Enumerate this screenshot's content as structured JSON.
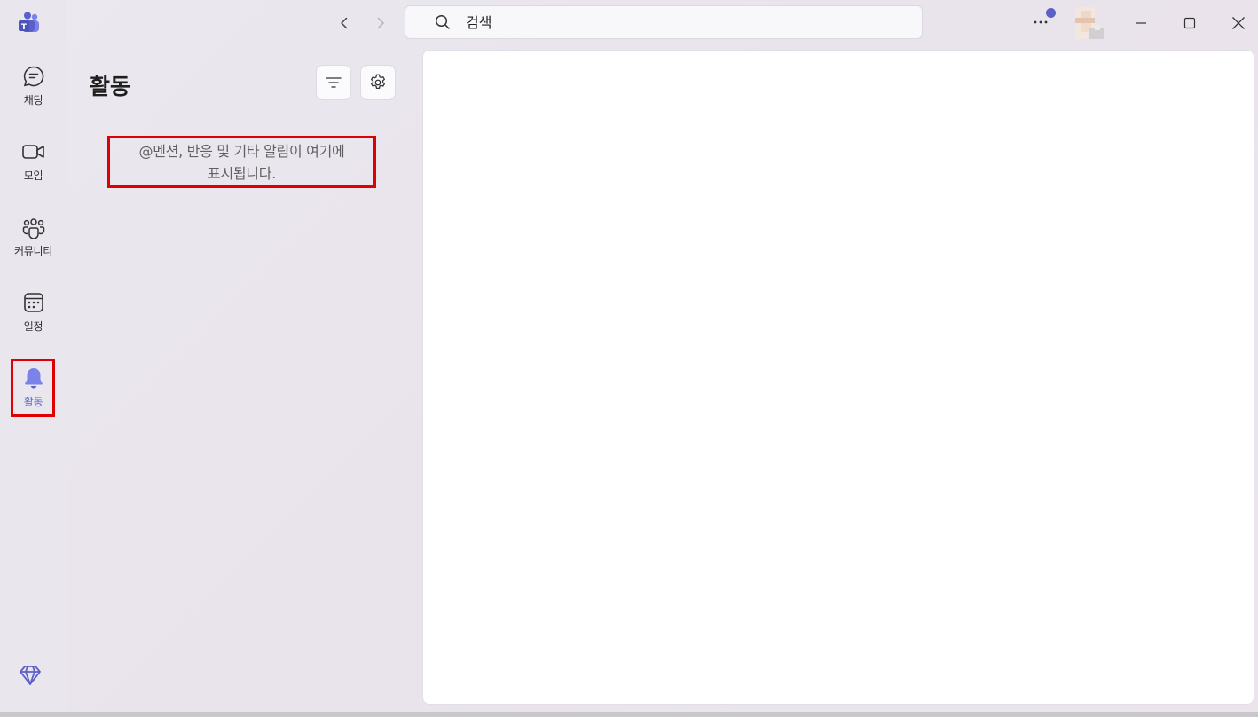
{
  "rail": {
    "items": [
      {
        "label": "채팅",
        "icon": "chat-icon"
      },
      {
        "label": "모임",
        "icon": "video-icon"
      },
      {
        "label": "커뮤니티",
        "icon": "community-icon"
      },
      {
        "label": "일정",
        "icon": "calendar-icon"
      },
      {
        "label": "활동",
        "icon": "bell-icon",
        "active": true
      }
    ]
  },
  "search": {
    "placeholder": "검색"
  },
  "activity": {
    "title": "활동",
    "empty_line1": "@멘션, 반응 및 기타 알림이 여기에",
    "empty_line2": "표시됩니다."
  },
  "colors": {
    "accent": "#5b5fc7",
    "highlight": "#e00000"
  }
}
